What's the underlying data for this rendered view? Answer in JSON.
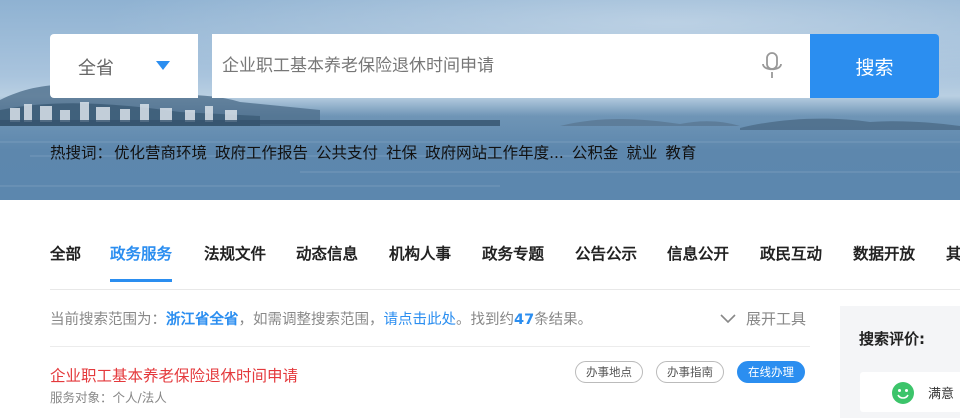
{
  "search": {
    "scope_label": "全省",
    "placeholder": "企业职工基本养老保险退休时间申请",
    "button_label": "搜索"
  },
  "hot_searches": {
    "label": "热搜词：",
    "items": [
      "优化营商环境",
      "政府工作报告",
      "公共支付",
      "社保",
      "政府网站工作年度...",
      "公积金",
      "就业",
      "教育"
    ]
  },
  "tabs": [
    {
      "label": "全部"
    },
    {
      "label": "政务服务"
    },
    {
      "label": "法规文件"
    },
    {
      "label": "动态信息"
    },
    {
      "label": "机构人事"
    },
    {
      "label": "政务专题"
    },
    {
      "label": "公告公示"
    },
    {
      "label": "信息公开"
    },
    {
      "label": "政民互动"
    },
    {
      "label": "数据开放"
    },
    {
      "label": "其"
    }
  ],
  "active_tab": "政务服务",
  "scope_info": {
    "prefix": "当前搜索范围为：",
    "province": "浙江省全省",
    "middle": "，如需调整搜索范围，",
    "link": "请点击此处",
    "found_prefix": "。找到约",
    "count": "47",
    "found_suffix": "条结果。"
  },
  "expand_tools_label": "展开工具",
  "results": [
    {
      "title": "企业职工基本养老保险退休时间申请",
      "meta": "服务对象：个人/法人",
      "actions": [
        "办事地点",
        "办事指南",
        "在线办理"
      ]
    }
  ],
  "rating": {
    "title": "搜索评价:",
    "option_label": "满意"
  },
  "colors": {
    "accent": "#2b8ef0",
    "result_title": "#e4393c",
    "rating_smile": "#3cc46a"
  }
}
